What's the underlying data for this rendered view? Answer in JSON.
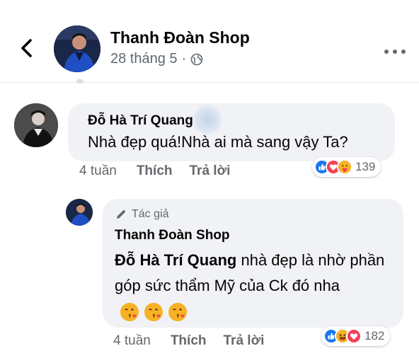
{
  "post": {
    "page_name": "Thanh Đoàn Shop",
    "date": "28 tháng 5",
    "separator": "·",
    "privacy_icon": "globe-icon",
    "more_icon": "more-horizontal-icon"
  },
  "comments": [
    {
      "author": "Đỗ Hà Trí Quang",
      "text": "Nhà đẹp quá!Nhà ai mà sang vậy Ta?",
      "time": "4 tuần",
      "like_label": "Thích",
      "reply_label": "Trả lời",
      "reaction_icons": [
        "like-icon",
        "love-icon",
        "care-icon"
      ],
      "reaction_count": "139"
    },
    {
      "author_badge": "Tác giả",
      "author": "Thanh Đoàn Shop",
      "mention": "Đỗ Hà Trí Quang",
      "text": " nhà đẹp là nhờ phần góp sức thẩm Mỹ của Ck đó nha",
      "emojis": [
        "kissing-heart-emoji",
        "kissing-heart-emoji",
        "kissing-heart-emoji"
      ],
      "time": "4 tuần",
      "like_label": "Thích",
      "reply_label": "Trả lời",
      "reaction_icons": [
        "like-icon",
        "haha-icon",
        "love-icon"
      ],
      "reaction_count": "182"
    }
  ],
  "colors": {
    "like_blue": "#1877f2",
    "love_red": "#f33e58",
    "bubble_gray": "#f0f2f5",
    "meta_gray": "#65676b",
    "emoji_yellow": "#f7b125"
  }
}
